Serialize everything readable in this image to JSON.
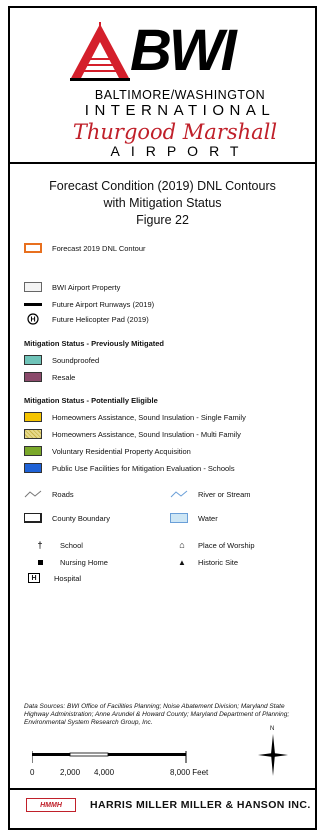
{
  "logo": {
    "brand": "BWI",
    "line1": "BALTIMORE/WASHINGTON",
    "line2": "INTERNATIONAL",
    "line3": "Thurgood Marshall",
    "line4": "AIRPORT"
  },
  "title": {
    "line1": "Forecast Condition (2019) DNL Contours",
    "line2": "with Mitigation Status",
    "line3": "Figure 22"
  },
  "legend": {
    "contour": {
      "label": "Forecast 2019 DNL Contour",
      "color": "#e8701f"
    },
    "airport_property": {
      "label": "BWI Airport Property"
    },
    "future_runway": {
      "label": "Future Airport Runways (2019)"
    },
    "helicopter_pad": {
      "label": "Future Helicopter Pad (2019)"
    },
    "previously_mitigated": {
      "header": "Mitigation Status - Previously Mitigated",
      "items": [
        {
          "label": "Soundproofed",
          "color": "#6fc3b8"
        },
        {
          "label": "Resale",
          "color": "#8b4a6b"
        }
      ]
    },
    "potentially_eligible": {
      "header": "Mitigation Status - Potentially Eligible",
      "items": [
        {
          "label": "Homeowners Assistance, Sound Insulation - Single Family",
          "color": "#f5c400"
        },
        {
          "label": "Homeowners Assistance, Sound Insulation - Multi Family",
          "color": "#e6d98a"
        },
        {
          "label": "Voluntary Residential Property Acquisition",
          "color": "#7aa82a"
        },
        {
          "label": "Public Use Facilities for Mitigation Evaluation - Schools",
          "color": "#1f62d6"
        }
      ]
    },
    "features": {
      "roads": "Roads",
      "river": "River or Stream",
      "county": "County Boundary",
      "water": "Water",
      "school": "School",
      "worship": "Place of Worship",
      "nursing": "Nursing Home",
      "historic": "Historic Site",
      "hospital": "Hospital"
    }
  },
  "sources": "Data Sources: BWI Office of Facilities Planning; Noise Abatement Division; Maryland State Highway Administration; Anne Arundel & Howard County; Maryland Department of Planning; Environmental System Research Group, Inc.",
  "scale": {
    "t0": "0",
    "t1": "2,000",
    "t2": "4,000",
    "t3": "8,000 Feet"
  },
  "north": "N",
  "firm": {
    "logo": "HMMH",
    "name": "HARRIS MILLER MILLER & HANSON INC."
  }
}
